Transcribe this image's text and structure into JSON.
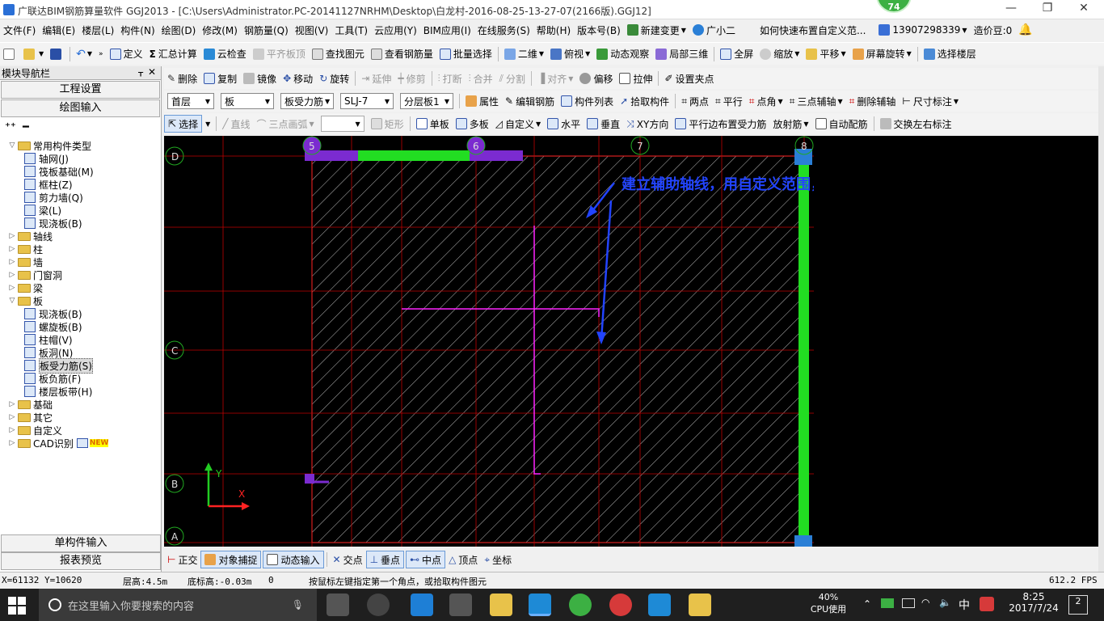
{
  "window": {
    "title": "广联达BIM钢筋算量软件 GGJ2013 - [C:\\Users\\Administrator.PC-20141127NRHM\\Desktop\\白龙村-2016-08-25-13-27-07(2166版).GGJ12]",
    "badge": "74",
    "controls": [
      "—",
      "❐",
      "✕"
    ]
  },
  "menubar": {
    "items": [
      "文件(F)",
      "编辑(E)",
      "楼层(L)",
      "构件(N)",
      "绘图(D)",
      "修改(M)",
      "钢筋量(Q)",
      "视图(V)",
      "工具(T)",
      "云应用(Y)",
      "BIM应用(I)",
      "在线服务(S)",
      "帮助(H)",
      "版本号(B)",
      "新建变更",
      "广小二",
      "如何快速布置自定义范...",
      "13907298339",
      "造价豆:0"
    ]
  },
  "toolbar1": {
    "items": [
      "定义",
      "汇总计算",
      "云检查",
      "平齐板顶",
      "查找图元",
      "查看钢筋量",
      "批量选择",
      "二维",
      "俯视",
      "动态观察",
      "局部三维",
      "全屏",
      "缩放",
      "平移",
      "屏幕旋转",
      "选择楼层"
    ]
  },
  "toolbar2": {
    "items": [
      "删除",
      "复制",
      "镜像",
      "移动",
      "旋转",
      "延伸",
      "修剪",
      "打断",
      "合并",
      "分割",
      "对齐",
      "偏移",
      "拉伸",
      "设置夹点"
    ]
  },
  "toolbar3": {
    "floor": "首层",
    "category": "板",
    "type": "板受力筋",
    "name": "SLJ-7",
    "layer": "分层板1",
    "items": [
      "属性",
      "编辑钢筋",
      "构件列表",
      "拾取构件",
      "两点",
      "平行",
      "点角",
      "三点辅轴",
      "删除辅轴",
      "尺寸标注"
    ]
  },
  "toolbar4": {
    "items": [
      "选择",
      "直线",
      "三点画弧",
      "矩形",
      "单板",
      "多板",
      "自定义",
      "水平",
      "垂直",
      "XY方向",
      "平行边布置受力筋",
      "放射筋",
      "自动配筋",
      "交换左右标注"
    ]
  },
  "nav": {
    "title": "模块导航栏",
    "sec_top1": "工程设置",
    "sec_top2": "绘图输入",
    "sec_bottom1": "单构件输入",
    "sec_bottom2": "报表预览",
    "tree": [
      {
        "label": "常用构件类型",
        "level": 0,
        "open": true
      },
      {
        "label": "轴网(J)",
        "level": 1
      },
      {
        "label": "筏板基础(M)",
        "level": 1
      },
      {
        "label": "框柱(Z)",
        "level": 1
      },
      {
        "label": "剪力墙(Q)",
        "level": 1
      },
      {
        "label": "梁(L)",
        "level": 1
      },
      {
        "label": "现浇板(B)",
        "level": 1
      },
      {
        "label": "轴线",
        "level": 0
      },
      {
        "label": "柱",
        "level": 0
      },
      {
        "label": "墙",
        "level": 0
      },
      {
        "label": "门窗洞",
        "level": 0
      },
      {
        "label": "梁",
        "level": 0
      },
      {
        "label": "板",
        "level": 0,
        "open": true
      },
      {
        "label": "现浇板(B)",
        "level": 1
      },
      {
        "label": "螺旋板(B)",
        "level": 1
      },
      {
        "label": "柱帽(V)",
        "level": 1
      },
      {
        "label": "板洞(N)",
        "level": 1
      },
      {
        "label": "板受力筋(S)",
        "level": 1,
        "selected": true
      },
      {
        "label": "板负筋(F)",
        "level": 1
      },
      {
        "label": "楼层板带(H)",
        "level": 1
      },
      {
        "label": "基础",
        "level": 0
      },
      {
        "label": "其它",
        "level": 0
      },
      {
        "label": "自定义",
        "level": 0
      },
      {
        "label": "CAD识别",
        "level": 0,
        "new": "NEW"
      }
    ]
  },
  "canvas": {
    "annotation": "建立辅助轴线，用自定义范围，XY方向",
    "axis_top": [
      "5",
      "6",
      "7",
      "8"
    ],
    "axis_left": [
      "D",
      "C",
      "B",
      "A"
    ],
    "ucs_x": "X",
    "ucs_y": "Y",
    "colors": {
      "grid": "#c00000",
      "slab_edge": "#ff5555",
      "wall": "#22dd22",
      "column": "#7b2bd0",
      "aux": "#ff22ff",
      "arrow": "#2244ff",
      "hatch": "#bbbbbb"
    }
  },
  "bottombar": {
    "items": [
      "正交",
      "对象捕捉",
      "动态输入",
      "交点",
      "垂点",
      "中点",
      "顶点",
      "坐标"
    ]
  },
  "status": {
    "coords": "X=61132 Y=10620",
    "floor_height": "层高:4.5m",
    "bottom_elev": "底标高:-0.03m",
    "value": "0",
    "hint": "按鼠标左键指定第一个角点，或拾取构件图元",
    "fps": "612.2 FPS"
  },
  "taskbar": {
    "search_placeholder": "在这里输入你要搜索的内容",
    "cpu_percent": "40%",
    "cpu_label": "CPU使用",
    "ime": "中",
    "time": "8:25",
    "date": "2017/7/24",
    "notify": "2"
  }
}
